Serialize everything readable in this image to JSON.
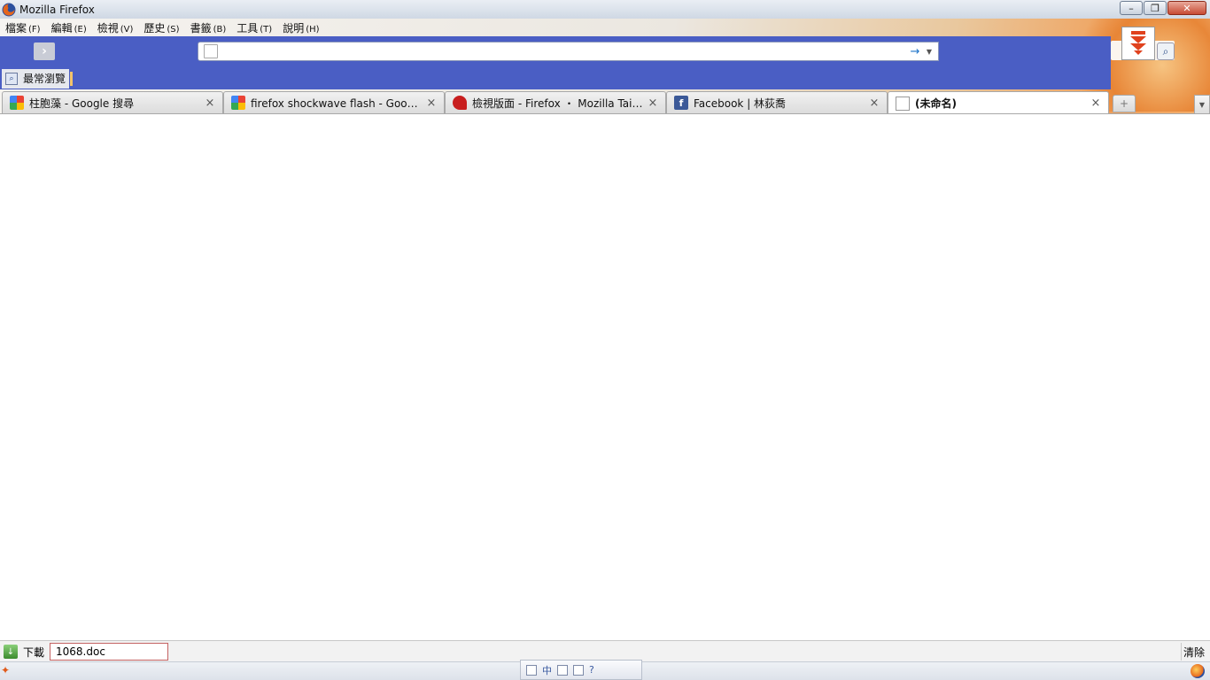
{
  "window": {
    "title": "Mozilla Firefox",
    "minimize": "–",
    "maximize": "❐",
    "close": "✕"
  },
  "menubar": {
    "items": [
      {
        "label": "檔案",
        "accel": "(F)"
      },
      {
        "label": "編輯",
        "accel": "(E)"
      },
      {
        "label": "檢視",
        "accel": "(V)"
      },
      {
        "label": "歷史",
        "accel": "(S)"
      },
      {
        "label": "書籤",
        "accel": "(B)"
      },
      {
        "label": "工具",
        "accel": "(T)"
      },
      {
        "label": "說明",
        "accel": "(H)"
      }
    ]
  },
  "navbar": {
    "back_glyph": "›",
    "url_value": "",
    "go_glyph": "→",
    "dropdown_glyph": "▼",
    "search_glyph": "⌕",
    "download_glyph": "⏬"
  },
  "bookmarks": {
    "items": [
      {
        "label": "最常瀏覽"
      }
    ]
  },
  "tabs": [
    {
      "label": "柱胞藻 - Google 搜尋",
      "icon": "google-icon",
      "selected": false
    },
    {
      "label": "firefox shockwave flash - Google 搜尋",
      "icon": "google-icon",
      "selected": false
    },
    {
      "label": "檢視版面 - Firefox ・ Mozilla Taiwa...",
      "icon": "mozilla-icon",
      "selected": false
    },
    {
      "label": "Facebook | 林荻喬",
      "icon": "facebook-icon",
      "selected": false
    },
    {
      "label": "(未命名)",
      "icon": "page-icon",
      "selected": true
    }
  ],
  "tab_close_glyph": "×",
  "newtab_glyph": "+",
  "tablist_glyph": "▼",
  "downloads": {
    "label": "下載",
    "file": "1068.doc",
    "clear": "清除"
  },
  "ime": {
    "mode": "中"
  },
  "colors": {
    "toolbar_blue": "#4a5ec4",
    "accent_orange": "#e6802f"
  }
}
